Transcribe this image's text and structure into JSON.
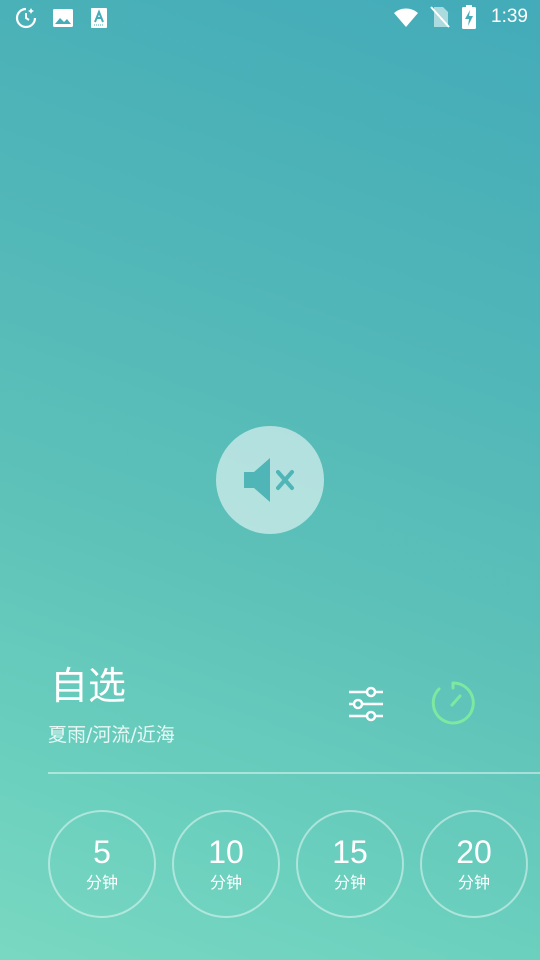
{
  "status_bar": {
    "time": "1:39",
    "left_icons": [
      "moon-clock-icon",
      "image-icon",
      "font-a-icon"
    ],
    "right_icons": [
      "wifi-icon",
      "no-sim-icon",
      "battery-charging-icon"
    ]
  },
  "player": {
    "mute_icon": "volume-mute-icon",
    "mode_title": "自选",
    "mode_subtitle": "夏雨/河流/近海",
    "mixer_icon": "sliders-icon",
    "timer_icon": "timer-icon"
  },
  "timer_options": [
    {
      "value": "5",
      "unit": "分钟"
    },
    {
      "value": "10",
      "unit": "分钟"
    },
    {
      "value": "15",
      "unit": "分钟"
    },
    {
      "value": "20",
      "unit": "分钟"
    }
  ],
  "colors": {
    "gradient_top": "#43abb9",
    "gradient_bottom": "#79d8c1",
    "timer_accent": "#7de8a0",
    "mute_icon": "#4fb5b6"
  }
}
